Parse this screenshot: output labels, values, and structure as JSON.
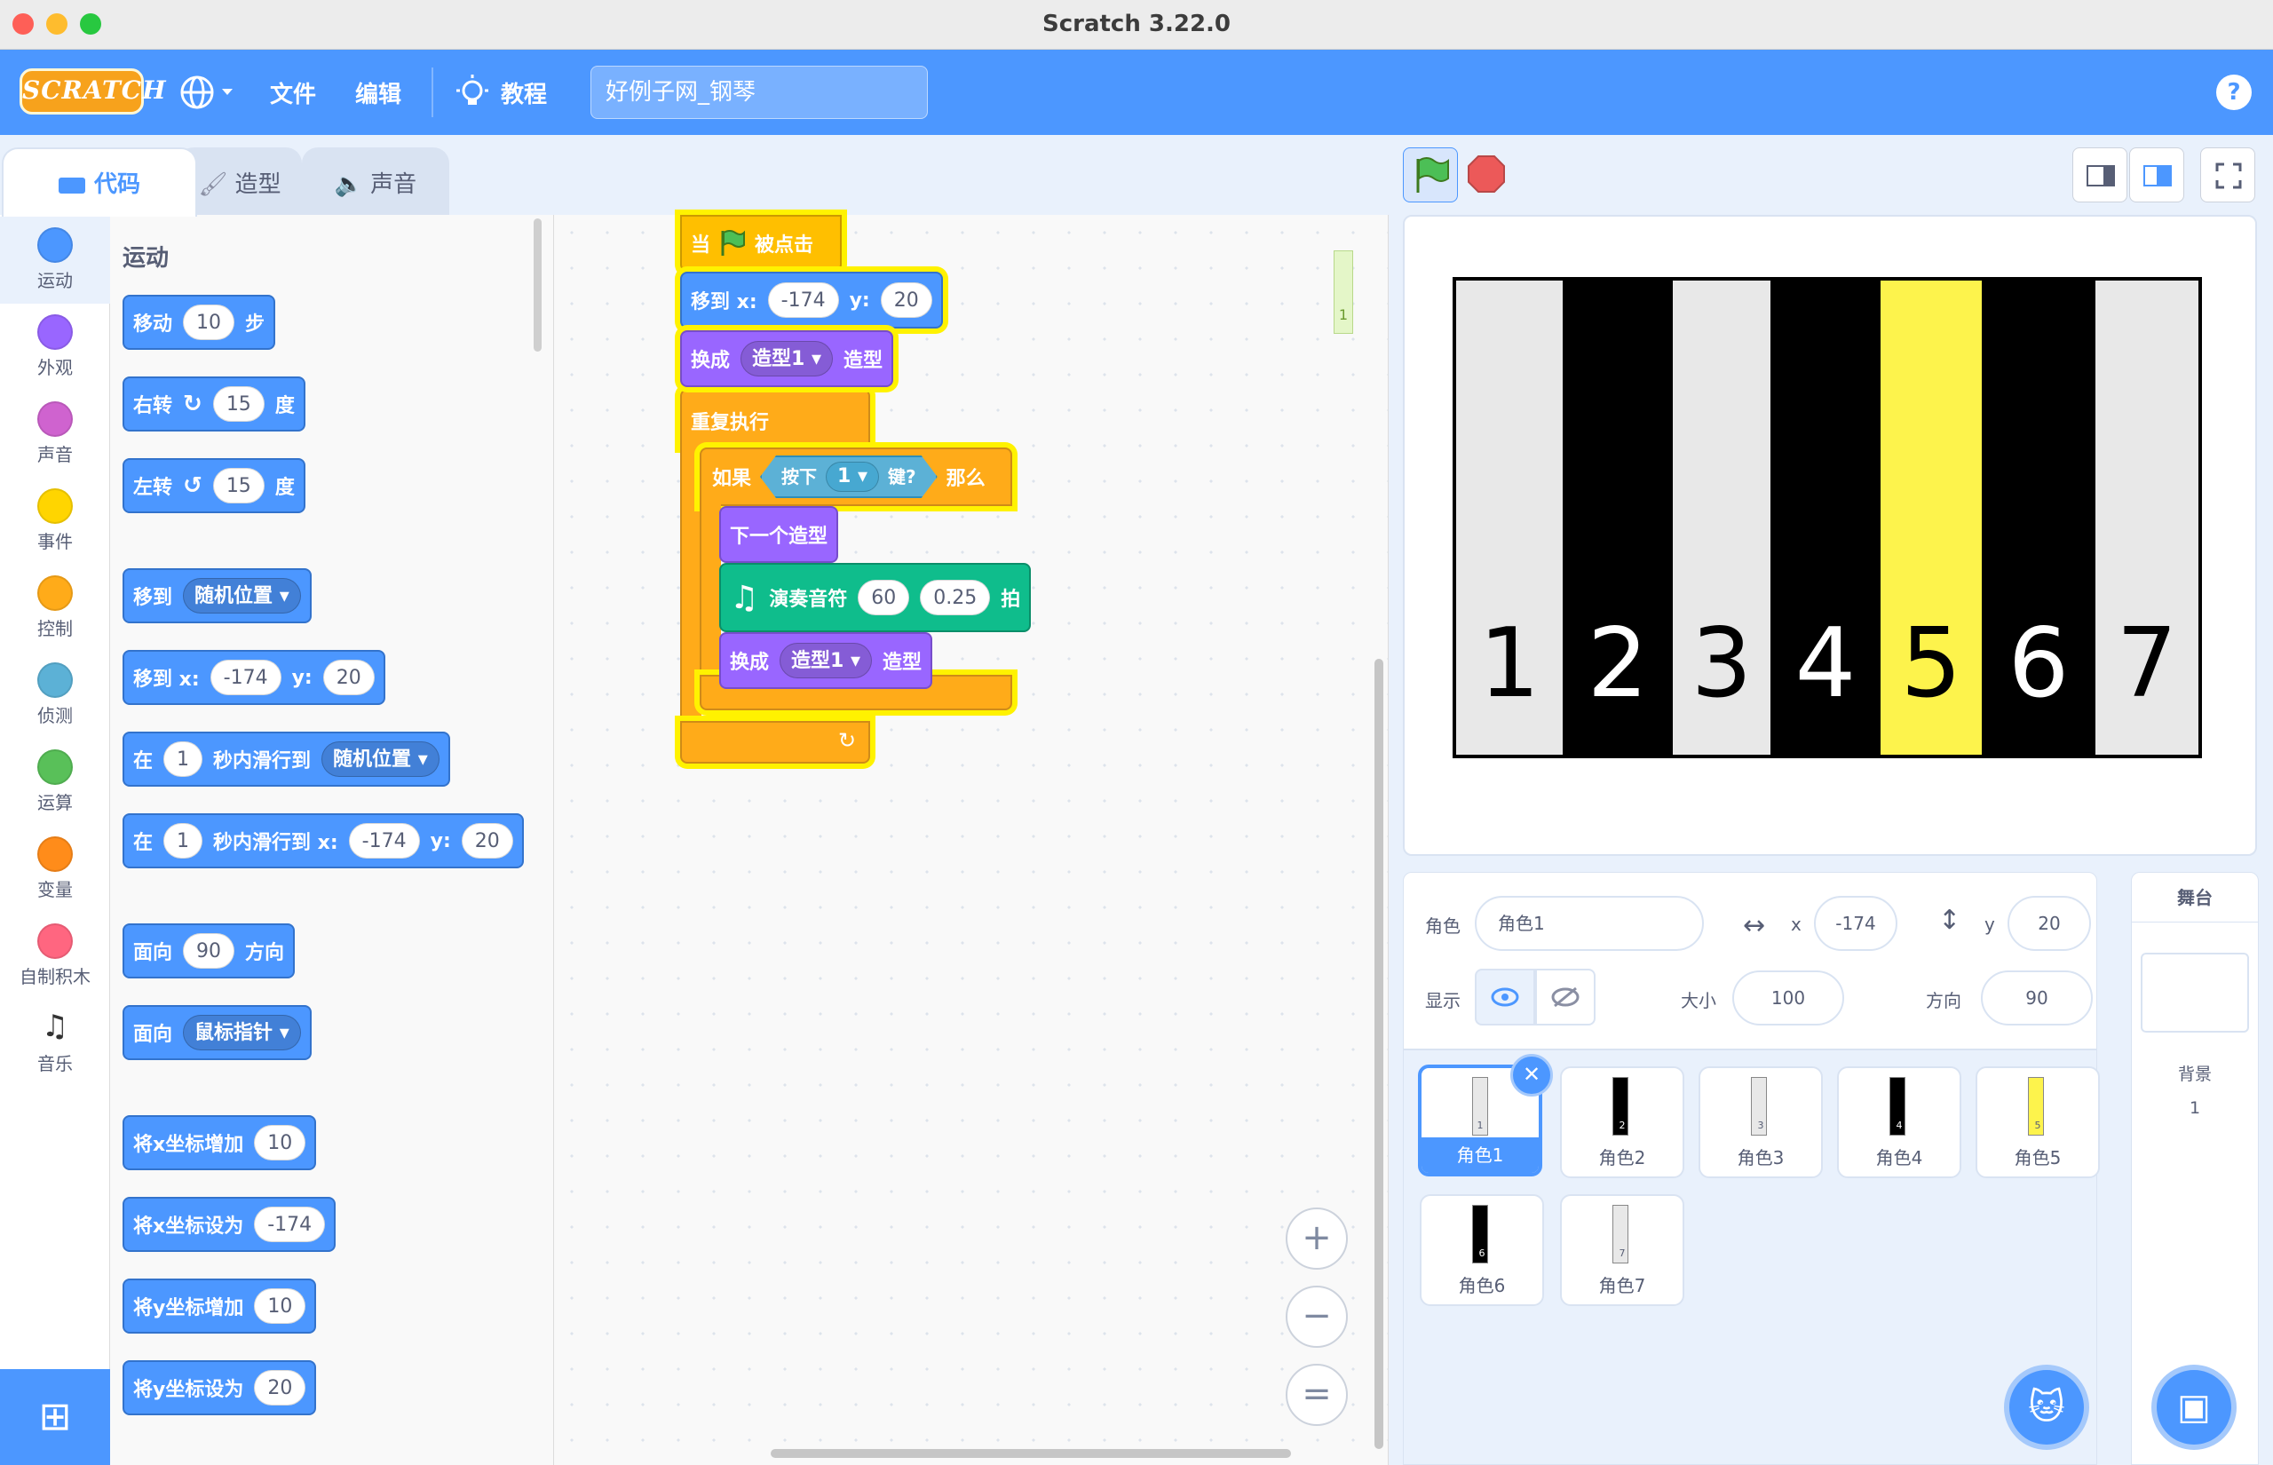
{
  "window": {
    "title": "Scratch 3.22.0"
  },
  "menubar": {
    "logo": "SCRATCH",
    "file": "文件",
    "edit": "编辑",
    "tutorials": "教程",
    "project_title": "好例子网_钢琴",
    "help": "?"
  },
  "tabs": {
    "code": "代码",
    "costumes": "造型",
    "sounds": "声音"
  },
  "categories": [
    {
      "label": "运动",
      "color": "#4c97ff"
    },
    {
      "label": "外观",
      "color": "#9966ff"
    },
    {
      "label": "声音",
      "color": "#cf63cf"
    },
    {
      "label": "事件",
      "color": "#ffd500"
    },
    {
      "label": "控制",
      "color": "#ffab19"
    },
    {
      "label": "侦测",
      "color": "#5cb1d6"
    },
    {
      "label": "运算",
      "color": "#59c059"
    },
    {
      "label": "变量",
      "color": "#ff8c1a"
    },
    {
      "label": "自制积木",
      "color": "#ff6680"
    },
    {
      "label": "音乐",
      "color": "#0fbd8c"
    }
  ],
  "palette": {
    "heading": "运动",
    "move": {
      "a": "移动",
      "v": "10",
      "b": "步"
    },
    "turn_right": {
      "a": "右转",
      "v": "15",
      "b": "度"
    },
    "turn_left": {
      "a": "左转",
      "v": "15",
      "b": "度"
    },
    "goto": {
      "a": "移到",
      "d": "随机位置"
    },
    "goto_xy": {
      "a": "移到 x:",
      "x": "-174",
      "b": "y:",
      "y": "20"
    },
    "glide": {
      "a": "在",
      "v": "1",
      "b": "秒内滑行到",
      "d": "随机位置"
    },
    "glide_xy": {
      "a": "在",
      "v": "1",
      "b": "秒内滑行到 x:",
      "x": "-174",
      "c": "y:",
      "y": "20"
    },
    "point_dir": {
      "a": "面向",
      "v": "90",
      "b": "方向"
    },
    "point_towards": {
      "a": "面向",
      "d": "鼠标指针"
    },
    "change_x": {
      "a": "将x坐标增加",
      "v": "10"
    },
    "set_x": {
      "a": "将x坐标设为",
      "v": "-174"
    },
    "change_y": {
      "a": "将y坐标增加",
      "v": "10"
    },
    "set_y": {
      "a": "将y坐标设为",
      "v": "20"
    }
  },
  "script": {
    "hat_a": "当",
    "hat_b": "被点击",
    "goto_a": "移到 x:",
    "goto_x": "-174",
    "goto_b": "y:",
    "goto_y": "20",
    "costume_a": "换成",
    "costume_d": "造型1",
    "costume_b": "造型",
    "forever": "重复执行",
    "if_a": "如果",
    "key_a": "按下",
    "key_d": "1",
    "key_b": "键?",
    "if_b": "那么",
    "next": "下一个造型",
    "play_a": "演奏音符",
    "play_n": "60",
    "play_t": "0.25",
    "play_b": "拍",
    "costume2_a": "换成",
    "costume2_d": "造型1",
    "costume2_b": "造型",
    "mini_count": "1"
  },
  "zoom": {
    "in": "+",
    "out": "−",
    "reset": "="
  },
  "stage_keys": [
    {
      "label": "1",
      "color": "#e8e8e8",
      "text": "#000000"
    },
    {
      "label": "2",
      "color": "#000000",
      "text": "#ffffff"
    },
    {
      "label": "3",
      "color": "#e8e8e8",
      "text": "#000000"
    },
    {
      "label": "4",
      "color": "#000000",
      "text": "#ffffff"
    },
    {
      "label": "5",
      "color": "#fdf34c",
      "text": "#000000"
    },
    {
      "label": "6",
      "color": "#000000",
      "text": "#ffffff"
    },
    {
      "label": "7",
      "color": "#e8e8e8",
      "text": "#000000"
    }
  ],
  "sprite_info": {
    "sprite_label": "角色",
    "sprite_name": "角色1",
    "x_label": "x",
    "x": "-174",
    "y_label": "y",
    "y": "20",
    "show_label": "显示",
    "size_label": "大小",
    "size": "100",
    "direction_label": "方向",
    "direction": "90"
  },
  "sprites": [
    {
      "name": "角色1",
      "num": "1",
      "color": "#e8e8e8"
    },
    {
      "name": "角色2",
      "num": "2",
      "color": "#000000"
    },
    {
      "name": "角色3",
      "num": "3",
      "color": "#e8e8e8"
    },
    {
      "name": "角色4",
      "num": "4",
      "color": "#000000"
    },
    {
      "name": "角色5",
      "num": "5",
      "color": "#fdf34c"
    },
    {
      "name": "角色6",
      "num": "6",
      "color": "#000000"
    },
    {
      "name": "角色7",
      "num": "7",
      "color": "#e8e8e8"
    }
  ],
  "stage_panel": {
    "title": "舞台",
    "backdrop_label": "背景",
    "backdrop_count": "1"
  }
}
